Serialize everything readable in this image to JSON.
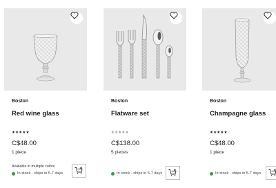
{
  "products": [
    {
      "brand": "Boston",
      "name": "Red wine glass",
      "rating_stars": "★★★★★",
      "price": "C$48.00",
      "quantity": "1 piece",
      "variants_note": "Available in multiple colors",
      "stock": "In stock - ships in 5-7 days",
      "image_icon": "wine-glass-icon"
    },
    {
      "brand": "Boston",
      "name": "Flatware set",
      "rating_stars": "★★★★★",
      "price": "C$138.00",
      "quantity": "5 pieces",
      "stock": "In stock - ships in 5-7 days",
      "image_icon": "flatware-icon"
    },
    {
      "brand": "Boston",
      "name": "Champagne glass",
      "rating_stars": "★★★★★",
      "price": "C$48.00",
      "quantity": "1 piece",
      "stock": "In stock - ships in 5-7 days",
      "image_icon": "champagne-glass-icon"
    }
  ],
  "colors": {
    "image_bg": "#e9e9e9",
    "in_stock": "#2e9e4a",
    "text": "#222222"
  }
}
